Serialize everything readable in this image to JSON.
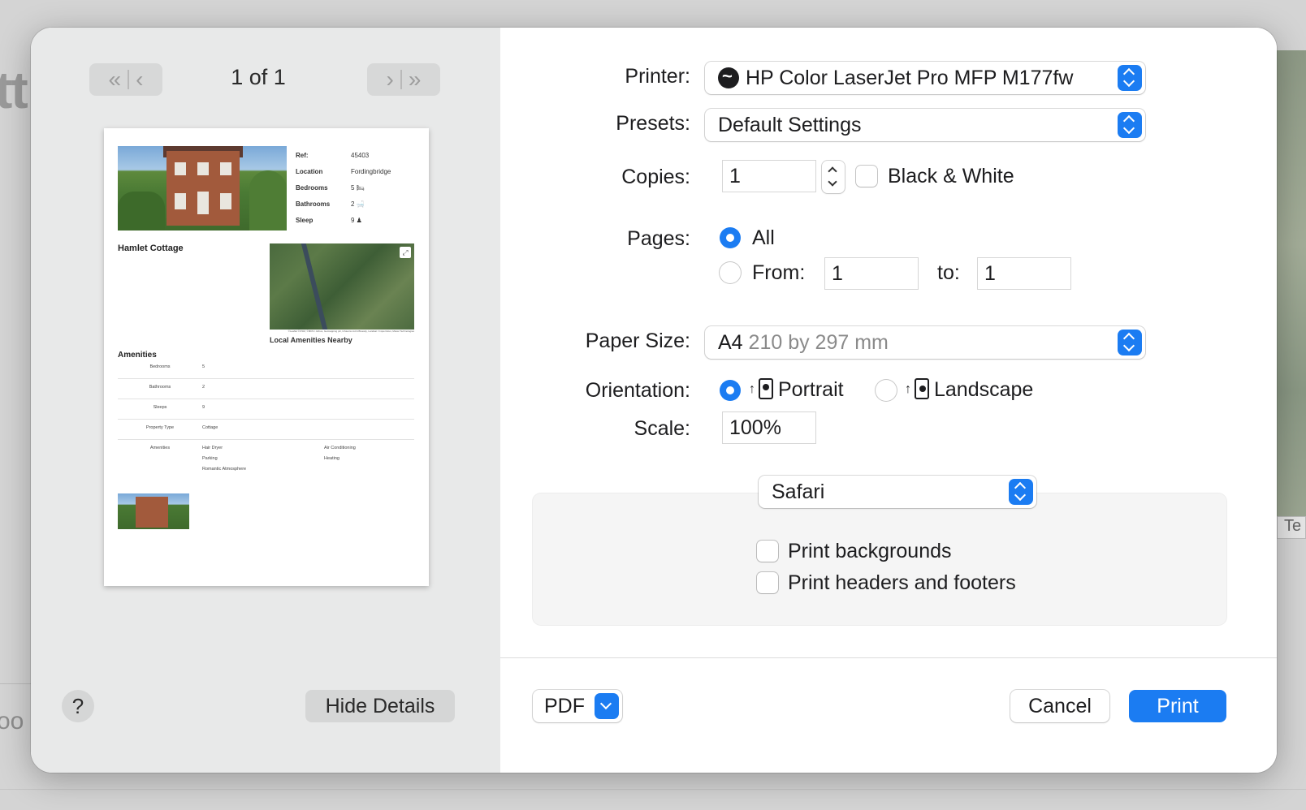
{
  "background": {
    "fragment_top": "tt",
    "fragment_bottom": "oo",
    "map_tab": "Te"
  },
  "preview": {
    "page_count": "1 of 1",
    "property": {
      "info": [
        {
          "key": "Ref:",
          "value": "45403"
        },
        {
          "key": "Location",
          "value": "Fordingbridge"
        },
        {
          "key": "Bedrooms",
          "value": "5 🛏"
        },
        {
          "key": "Bathrooms",
          "value": "2 🛁"
        },
        {
          "key": "Sleep",
          "value": "9 ♟"
        }
      ],
      "title": "Hamlet Cottage",
      "map_credit": "©Leaflet ©OSM, ©MDS / Airbus, Getmapping plc, Infoterra Ltd & Bluesky, Landsat / Copernicus, Maxar Technologies",
      "map_caption": "Local Amenities Nearby",
      "amenities_title": "Amenities",
      "amenities": [
        {
          "key": "Bedrooms",
          "value": "5"
        },
        {
          "key": "Bathrooms",
          "value": "2"
        },
        {
          "key": "Sleeps",
          "value": "9"
        },
        {
          "key": "Property Type",
          "value": "Cottage"
        }
      ],
      "amenities_list_label": "Amenities",
      "amenities_list": [
        "Hair Dryer",
        "Air Conditioning",
        "Parking",
        "Heating",
        "Romantic Atmosphere",
        ""
      ]
    }
  },
  "left_footer": {
    "help": "?",
    "hide_details": "Hide Details"
  },
  "form": {
    "printer_label": "Printer:",
    "printer_value": "HP Color LaserJet Pro MFP M177fw",
    "presets_label": "Presets:",
    "presets_value": "Default Settings",
    "copies_label": "Copies:",
    "copies_value": "1",
    "bw_label": "Black & White",
    "pages_label": "Pages:",
    "pages_all": "All",
    "pages_from": "From:",
    "from_value": "1",
    "pages_to": "to:",
    "to_value": "1",
    "paper_label": "Paper Size:",
    "paper_value": "A4",
    "paper_dims": "210 by 297 mm",
    "orientation_label": "Orientation:",
    "portrait": "Portrait",
    "landscape": "Landscape",
    "scale_label": "Scale:",
    "scale_value": "100%",
    "app_popup": "Safari",
    "print_backgrounds": "Print backgrounds",
    "print_headers": "Print headers and footers"
  },
  "footer": {
    "pdf": "PDF",
    "cancel": "Cancel",
    "print": "Print"
  },
  "colors": {
    "accent": "#1b7cf2",
    "sidebar_bg": "#e8e9e9"
  }
}
